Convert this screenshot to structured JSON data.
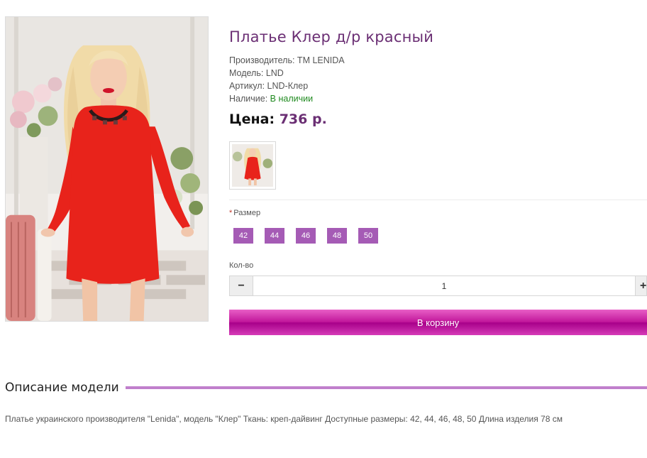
{
  "product": {
    "title": "Платье Клер д/р красный",
    "manufacturer_line": "Производитель: ТМ LENIDA",
    "model_line": "Модель: LND",
    "sku_line": "Артикул: LND-Клер",
    "availability_label": "Наличие:",
    "availability_value": "В наличии",
    "price_label": "Цена:",
    "price_value": "736 р."
  },
  "options": {
    "required_mark": "*",
    "size_label": "Размер",
    "sizes": [
      "42",
      "44",
      "46",
      "48",
      "50"
    ]
  },
  "quantity": {
    "label": "Кол-во",
    "value": "1",
    "minus_symbol": "−",
    "plus_symbol": "+"
  },
  "cart": {
    "button_label": "В корзину"
  },
  "description": {
    "heading": "Описание модели",
    "text": "Платье украинского производителя \"Lenida\", модель \"Клер\" Ткань: креп-дайвинг Доступные размеры: 42, 44, 46, 48, 50 Длина изделия 78 см"
  },
  "colors": {
    "accent": "#6b2f74",
    "size_button": "#a55bb5",
    "cart_button": "#c1179b",
    "in_stock": "#1f8a1f",
    "dress": "#e8231b"
  }
}
